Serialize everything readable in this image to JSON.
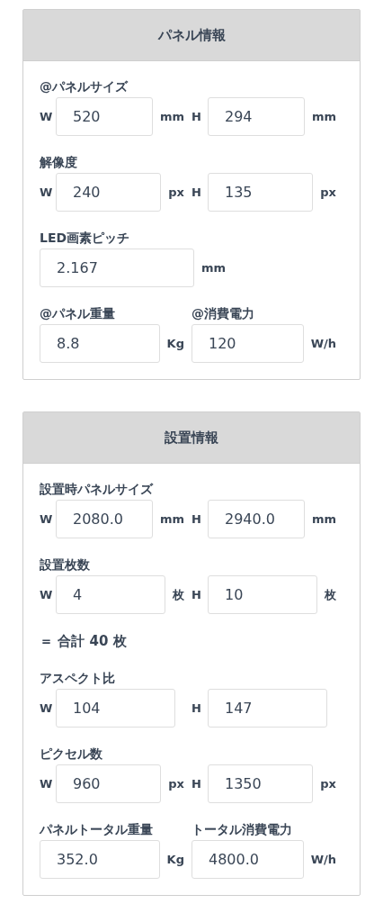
{
  "panels": [
    {
      "title": "パネル情報",
      "groups": [
        {
          "kind": "pair",
          "label": "@パネルサイズ",
          "fields": [
            {
              "prefix": "W",
              "value": "520",
              "unit": "mm"
            },
            {
              "prefix": "H",
              "value": "294",
              "unit": "mm"
            }
          ]
        },
        {
          "kind": "pair",
          "label": "解像度",
          "fields": [
            {
              "prefix": "W",
              "value": "240",
              "unit": "px"
            },
            {
              "prefix": "H",
              "value": "135",
              "unit": "px"
            }
          ]
        },
        {
          "kind": "single",
          "label": "LED画素ピッチ",
          "fields": [
            {
              "value": "2.167",
              "unit": "mm"
            }
          ]
        },
        {
          "kind": "split",
          "fields": [
            {
              "label": "@パネル重量",
              "value": "8.8",
              "unit": "Kg"
            },
            {
              "label": "@消費電力",
              "value": "120",
              "unit": "W/h"
            }
          ]
        }
      ]
    },
    {
      "title": "設置情報",
      "groups": [
        {
          "kind": "pair",
          "label": "設置時パネルサイズ",
          "fields": [
            {
              "prefix": "W",
              "value": "2080.0",
              "unit": "mm"
            },
            {
              "prefix": "H",
              "value": "2940.0",
              "unit": "mm"
            }
          ]
        },
        {
          "kind": "pair",
          "label": "設置枚数",
          "fields": [
            {
              "prefix": "W",
              "value": "4",
              "unit": "枚"
            },
            {
              "prefix": "H",
              "value": "10",
              "unit": "枚"
            }
          ]
        },
        {
          "kind": "total",
          "text": "＝ 合計 40 枚"
        },
        {
          "kind": "pair",
          "label": "アスペクト比",
          "fields": [
            {
              "prefix": "W",
              "value": "104"
            },
            {
              "prefix": "H",
              "value": "147"
            }
          ]
        },
        {
          "kind": "pair",
          "label": "ピクセル数",
          "fields": [
            {
              "prefix": "W",
              "value": "960",
              "unit": "px"
            },
            {
              "prefix": "H",
              "value": "1350",
              "unit": "px"
            }
          ]
        },
        {
          "kind": "split",
          "fields": [
            {
              "label": "パネルトータル重量",
              "value": "352.0",
              "unit": "Kg"
            },
            {
              "label": "トータル消費電力",
              "value": "4800.0",
              "unit": "W/h"
            }
          ]
        }
      ]
    }
  ]
}
